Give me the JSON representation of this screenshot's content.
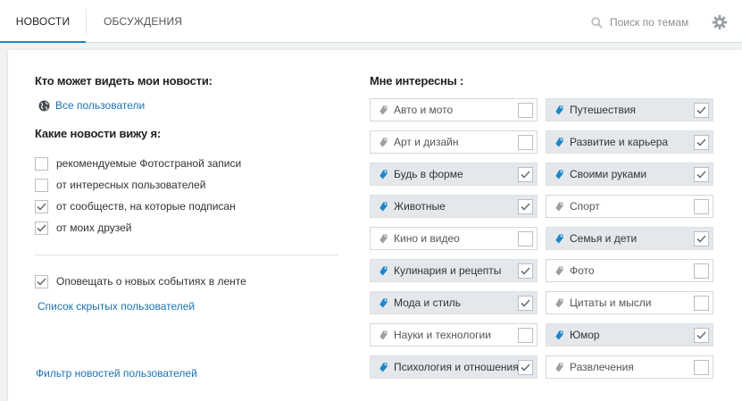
{
  "header": {
    "tabs": [
      {
        "label": "НОВОСТИ",
        "active": true
      },
      {
        "label": "ОБСУЖДЕНИЯ",
        "active": false
      }
    ],
    "search_placeholder": "Поиск по темам",
    "icons": {
      "search": "search-icon",
      "settings": "gear-icon"
    }
  },
  "left": {
    "visibility_title": "Кто может видеть мои новости:",
    "visibility_value": "Все пользователи",
    "which_title": "Какие новости вижу я:",
    "options": [
      {
        "label": "рекомендуемые Фотостраной записи",
        "checked": false
      },
      {
        "label": "от интересных пользователей",
        "checked": false
      },
      {
        "label": "от сообществ, на которые подписан",
        "checked": true
      },
      {
        "label": "от моих друзей",
        "checked": true
      }
    ],
    "notify": {
      "label": "Оповещать о новых событиях в ленте",
      "checked": true
    },
    "hidden_users_link": "Список скрытых пользователей",
    "filter_link": "Фильтр новостей пользователей"
  },
  "interests": {
    "title": "Мне интересны :",
    "topics": [
      {
        "label": "Авто и мото",
        "checked": false
      },
      {
        "label": "Путешествия",
        "checked": true
      },
      {
        "label": "Арт и дизайн",
        "checked": false
      },
      {
        "label": "Развитие и карьера",
        "checked": true
      },
      {
        "label": "Будь в форме",
        "checked": true
      },
      {
        "label": "Своими руками",
        "checked": true
      },
      {
        "label": "Животные",
        "checked": true
      },
      {
        "label": "Спорт",
        "checked": false
      },
      {
        "label": "Кино и видео",
        "checked": false
      },
      {
        "label": "Семья и дети",
        "checked": true
      },
      {
        "label": "Кулинария и рецепты",
        "checked": true
      },
      {
        "label": "Фото",
        "checked": false
      },
      {
        "label": "Мода и стиль",
        "checked": true
      },
      {
        "label": "Цитаты и мысли",
        "checked": false
      },
      {
        "label": "Науки и технологии",
        "checked": false
      },
      {
        "label": "Юмор",
        "checked": true
      },
      {
        "label": "Психология и отношения",
        "checked": true
      },
      {
        "label": "Развлечения",
        "checked": false
      }
    ]
  },
  "colors": {
    "accent": "#1b87c9",
    "link": "#1b73b3",
    "tag_on": "#1b87c9",
    "tag_off": "#9aa0a6"
  }
}
